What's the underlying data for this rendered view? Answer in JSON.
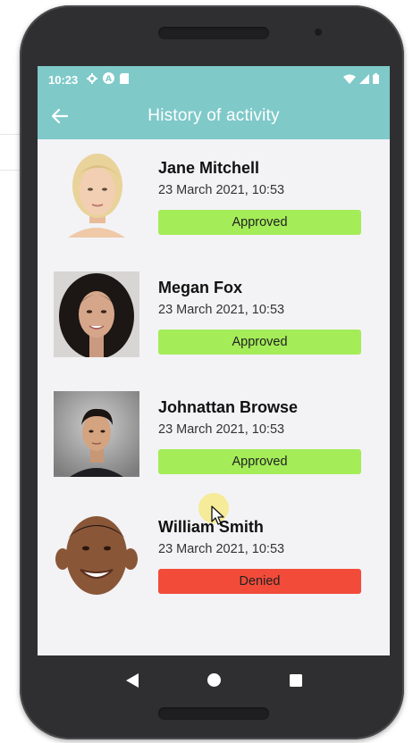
{
  "status_bar": {
    "time": "10:23"
  },
  "app_bar": {
    "title": "History of activity"
  },
  "activities": [
    {
      "name": "Jane Mitchell",
      "date": "23 March 2021, 10:53",
      "status": "Approved",
      "status_color": "#a4ec58"
    },
    {
      "name": "Megan Fox",
      "date": "23 March 2021, 10:53",
      "status": "Approved",
      "status_color": "#a4ec58"
    },
    {
      "name": "Johnattan Browse",
      "date": "23 March 2021, 10:53",
      "status": "Approved",
      "status_color": "#a4ec58"
    },
    {
      "name": "William Smith",
      "date": "23 March 2021, 10:53",
      "status": "Denied",
      "status_color": "#f24b3a"
    }
  ],
  "colors": {
    "header": "#7fc9c9",
    "screen_bg": "#f3f3f5",
    "phone_body": "#2f2f31"
  },
  "icons": [
    "back-arrow-icon",
    "settings-icon",
    "a-icon",
    "sd-card-icon",
    "wifi-icon",
    "signal-icon",
    "battery-icon",
    "nav-back-icon",
    "nav-home-icon",
    "nav-recents-icon"
  ]
}
